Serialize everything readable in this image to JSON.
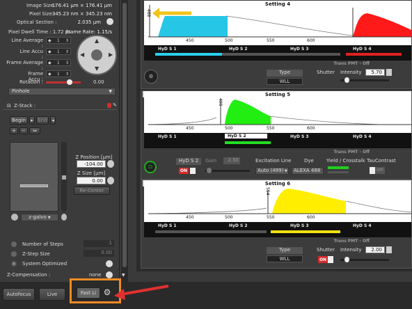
{
  "left_panel": {
    "image_size_label": "Image Size :",
    "image_size_value": "176.41 µm × 176.41 µm",
    "pixel_size_label": "Pixel Size :",
    "pixel_size_value": "345.23 nm × 345.23 nm",
    "optical_section_label": "Optical Section :",
    "optical_section_value": "2.035 µm",
    "pixel_dwell_label": "Pixel Dwell Time : 1.72 µs",
    "frame_rate_label": "Frame Rate: 1.15/s",
    "line_average_label": "Line Average :",
    "line_accu_label": "Line Accu :",
    "frame_average_label": "Frame Average :",
    "frame_accu_label": "Frame Accu :",
    "spin_value": "1",
    "rotation_label": "Rotation :",
    "rotation_value": "0.00",
    "pinhole_label": "Pinhole",
    "zstack_title": "Z-Stack :",
    "begin_label": "Begin",
    "end_label": "End",
    "zpos_label": "Z Position [µm]",
    "zpos_value": "-104.00",
    "zsize_label": "Z Size [µm]",
    "zsize_value": "0.00",
    "recenter_label": "Re-Center",
    "zgalvo_label": "z-galvo",
    "steps_label": "Number of Steps",
    "steps_value": "1",
    "zstep_label": "Z-Step Size",
    "zstep_value": "0.00",
    "sysopt_label": "System Optimized",
    "zcomp_label": "Z-Compensation :",
    "zcomp_value": "none"
  },
  "settings": [
    {
      "title": "Setting 4",
      "marker": "488",
      "detectors": [
        "HyD S 1",
        "HyD S 2",
        "HyD S 3",
        "HyD S 4"
      ],
      "ticks": [
        "450",
        "500",
        "550",
        "600",
        "650",
        "700",
        "750"
      ],
      "trans": "Trans PMT - Off"
    },
    {
      "title": "Setting 5",
      "marker": "499",
      "detectors": [
        "HyD S 1",
        "HyD S 2",
        "HyD S 3",
        "HyD S 4"
      ],
      "ticks": [
        "450",
        "500",
        "550",
        "600",
        "650",
        "700",
        "750"
      ],
      "trans": "Trans PMT - Off"
    },
    {
      "title": "Setting 6",
      "marker": "554",
      "detectors": [
        "HyD S 1",
        "HyD S 2",
        "HyD S 3",
        "HyD S 4"
      ],
      "ticks": [
        "450",
        "500",
        "550",
        "600",
        "650",
        "700",
        "750"
      ],
      "trans": "Trans PMT - Off"
    }
  ],
  "controls4": {
    "type_label": "Type",
    "type_value": "WLL",
    "shutter_label": "Shutter",
    "intensity_label": "Intensity",
    "intensity_value": "5.70",
    "shutter_state": "ON"
  },
  "controls5": {
    "detector_label": "HyD S 2",
    "gain_label": "Gain",
    "gain_value": "2.50",
    "excitation_label": "Excitation Line",
    "excitation_value": "Auto (499)",
    "dye_label": "Dye",
    "dye_value": "ALEXA 488",
    "yield_label": "Yield / Crosstalk",
    "taucontrast_label": "TauContrast",
    "off_label": "OFF",
    "on_label": "ON"
  },
  "controls6": {
    "type_label": "Type",
    "type_value": "WLL",
    "shutter_label": "Shutter",
    "intensity_label": "Intensity",
    "intensity_value": "2.00",
    "shutter_state": "ON"
  },
  "bottom": {
    "autofocus_label": "Autofocus",
    "live_label": "Live",
    "fastlive_label": "Fast Li"
  }
}
